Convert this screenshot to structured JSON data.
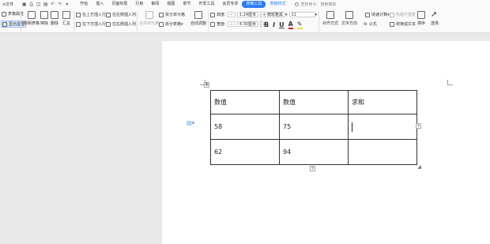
{
  "menubar": {
    "file": "文件",
    "tabs": [
      "开始",
      "插入",
      "页面布局",
      "引用",
      "审阅",
      "视图",
      "章节",
      "开发工具",
      "会员专享"
    ],
    "active_tab": "表格工具",
    "context_tab": "表格样式",
    "search": "查找命令、搜索模板"
  },
  "ribbon": {
    "table_props": "表格属性",
    "show_gridlines": "显示虚框",
    "draw_table": "绘制表格",
    "eraser": "擦除",
    "delete": "删除",
    "summary": "汇总",
    "insert_above": "在上方插入行",
    "insert_below": "在下方插入行",
    "insert_left": "在左侧插入列",
    "insert_right": "在右侧插入列",
    "merge_cells": "合并单元格",
    "split_cells": "拆分单元格",
    "split_table": "拆分表格",
    "auto_fit": "自动调整",
    "height_label": "高度:",
    "height_value": "1.24厘米",
    "width_label": "宽度:",
    "width_value": "4.30厘米",
    "font_name": "微软雅黑",
    "font_size": "11",
    "align": "对齐方式",
    "text_direction": "文字方向",
    "formula": "公式",
    "quick_calc": "快速计算",
    "repeat_header": "标题行重复",
    "convert_text": "转换成文本",
    "sort": "排序",
    "select": "选择"
  },
  "table": {
    "rows": [
      [
        "数值",
        "数值",
        "求和"
      ],
      [
        "58",
        "75",
        ""
      ],
      [
        "62",
        "94",
        ""
      ]
    ]
  },
  "colors": {
    "accent": "#2d7cf6",
    "page": "#ffffff",
    "canvas": "#e9e9e9"
  }
}
